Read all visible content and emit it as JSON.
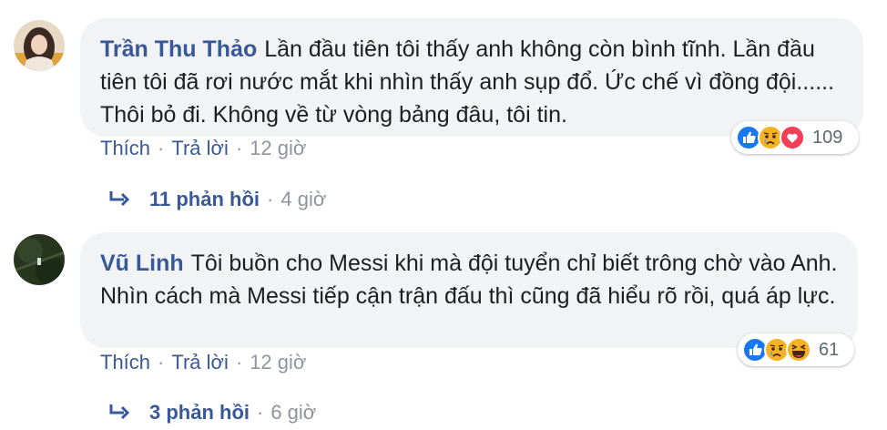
{
  "comments": [
    {
      "author": "Trần Thu Thảo",
      "text": "Lần đầu tiên tôi thấy anh không còn bình tĩnh. Lần đầu tiên tôi đã rơi nước mắt khi nhìn thấy anh sụp đổ. Ức chế vì đồng đội...... Thôi bỏ đi. Không về từ vòng bảng đâu, tôi tin.",
      "like_label": "Thích",
      "reply_label": "Trả lời",
      "time": "12 giờ",
      "reactions": {
        "icons": [
          "like-icon",
          "sad-icon",
          "love-icon"
        ],
        "count": "109"
      },
      "replies": {
        "label": "11 phản hồi",
        "time": "4 giờ"
      }
    },
    {
      "author": "Vũ Linh",
      "text": "Tôi buồn cho Messi khi mà đội tuyển chỉ biết trông chờ vào Anh. Nhìn cách mà Messi tiếp cận trận đấu thì cũng đã hiểu rõ rồi, quá áp lực.",
      "like_label": "Thích",
      "reply_label": "Trả lời",
      "time": "12 giờ",
      "reactions": {
        "icons": [
          "like-icon",
          "sad-icon",
          "haha-icon"
        ],
        "count": "61"
      },
      "replies": {
        "label": "3 phản hồi",
        "time": "6 giờ"
      }
    }
  ],
  "colors": {
    "author": "#385898",
    "bubble": "#f2f3f5",
    "meta": "#90949c",
    "like_blue": "#1877f2",
    "love_red": "#f33e58",
    "emoji_yellow": "#f7b125"
  }
}
